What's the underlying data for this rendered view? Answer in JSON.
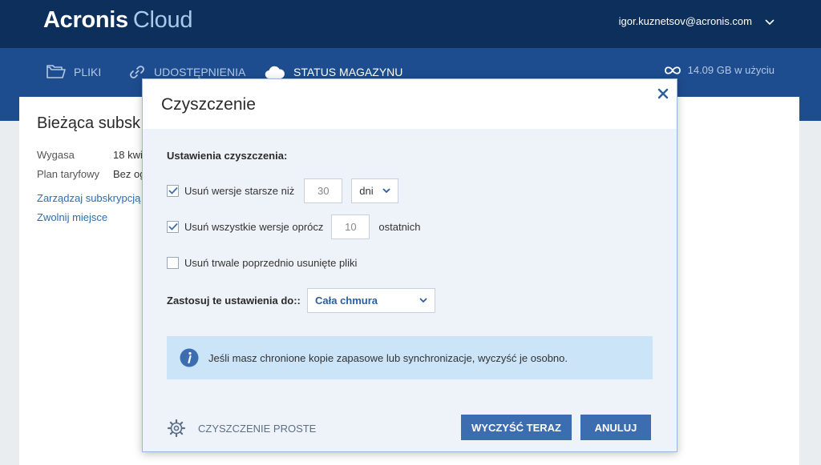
{
  "header": {
    "brand": "Acronis",
    "product": "Cloud",
    "user_email": "igor.kuznetsov@acronis.com"
  },
  "nav": {
    "items": [
      {
        "label": "PLIKI",
        "icon": "folder-icon"
      },
      {
        "label": "UDOSTĘPNIENIA",
        "icon": "link-icon"
      },
      {
        "label": "STATUS MAGAZYNU",
        "icon": "cloud-icon",
        "active": true
      }
    ],
    "usage": "14.09 GB w użyciu",
    "usage_icon": "infinity-icon"
  },
  "background_panel": {
    "title": "Bieżąca subsk",
    "expires_label": "Wygasa",
    "expires_value": "18 kwi",
    "plan_label": "Plan taryfowy",
    "plan_value": "Bez og",
    "manage_link": "Zarządzaj subskrypcją",
    "free_space_link": "Zwolnij miejsce"
  },
  "modal": {
    "title": "Czyszczenie",
    "section_title": "Ustawienia czyszczenia:",
    "option_older": {
      "checked": true,
      "label": "Usuń wersje starsze niż",
      "value": "30",
      "unit_selected": "dni"
    },
    "option_except": {
      "checked": true,
      "label": "Usuń wszystkie wersje oprócz",
      "value": "10",
      "suffix": "ostatnich"
    },
    "option_permanent": {
      "checked": false,
      "label": "Usuń trwale poprzednio usunięte pliki"
    },
    "apply_label": "Zastosuj te ustawienia do::",
    "apply_selected": "Cała chmura",
    "info_text": "Jeśli masz chronione kopie zapasowe lub synchronizacje, wyczyść je osobno.",
    "simple_cleanup": "CZYSZCZENIE PROSTE",
    "clean_now_button": "WYCZYŚĆ TERAZ",
    "cancel_button": "ANULUJ"
  },
  "colors": {
    "topbar": "#0c2f5b",
    "navbar": "#1d4d8f",
    "accent_button": "#3b6db0",
    "info_background": "#cbe4f7"
  }
}
